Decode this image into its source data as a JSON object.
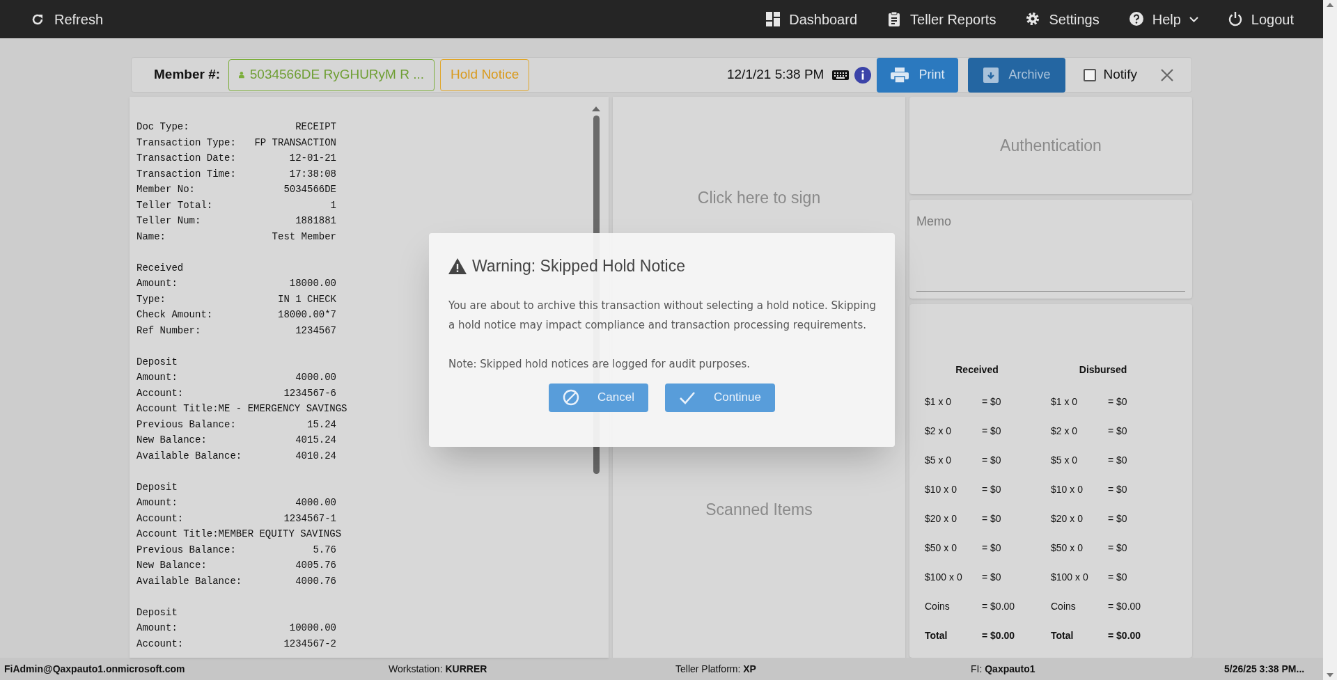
{
  "top_bar": {
    "refresh": "Refresh",
    "nav": [
      {
        "kind": "dashboard",
        "label": "Dashboard",
        "caret": false
      },
      {
        "kind": "reports",
        "label": "Teller Reports",
        "caret": false
      },
      {
        "kind": "settings",
        "label": "Settings",
        "caret": false
      },
      {
        "kind": "help",
        "label": "Help",
        "caret": true
      },
      {
        "kind": "logout",
        "label": "Logout",
        "caret": false
      }
    ]
  },
  "header": {
    "member_label": "Member #:",
    "member_value": "5034566DE RyGHURyM R ...",
    "hold_notice": "Hold Notice",
    "datetime": "12/1/21 5:38 PM",
    "print": "Print",
    "archive": "Archive",
    "notify": {
      "label": "Notify",
      "checked": false
    }
  },
  "receipt": {
    "sections": [
      {
        "rows": [
          {
            "kind": "pair",
            "label": "Doc Type:",
            "value": "RECEIPT"
          },
          {
            "kind": "pair",
            "label": "Transaction Type:",
            "value": "FP TRANSACTION"
          },
          {
            "kind": "pair",
            "label": "Transaction Date:",
            "value": "12-01-21"
          },
          {
            "kind": "pair",
            "label": "Transaction Time:",
            "value": "17:38:08"
          },
          {
            "kind": "pair",
            "label": "Member No:",
            "value": "5034566DE"
          },
          {
            "kind": "pair",
            "label": "Teller Total:",
            "value": "1"
          },
          {
            "kind": "pair",
            "label": "Teller Num:",
            "value": "1881881"
          },
          {
            "kind": "pair",
            "label": "Name:",
            "value": "Test Member"
          }
        ]
      },
      {
        "heading": "Received",
        "rows": [
          {
            "kind": "pair",
            "label": "Amount:",
            "value": "18000.00"
          },
          {
            "kind": "pair",
            "label": "Type:",
            "value": "IN 1 CHECK"
          },
          {
            "kind": "pair",
            "label": "Check Amount:",
            "value": "18000.00*7"
          },
          {
            "kind": "pair",
            "label": "Ref Number:",
            "value": "1234567"
          }
        ]
      },
      {
        "heading": "Deposit",
        "rows": [
          {
            "kind": "pair",
            "label": "Amount:",
            "value": "4000.00"
          },
          {
            "kind": "pair",
            "label": "Account:",
            "value": "1234567-6"
          },
          {
            "kind": "line",
            "text": "Account Title:ME - EMERGENCY SAVINGS"
          },
          {
            "kind": "pair",
            "label": "Previous Balance:",
            "value": "15.24"
          },
          {
            "kind": "pair",
            "label": "New Balance:",
            "value": "4015.24"
          },
          {
            "kind": "pair",
            "label": "Available Balance:",
            "value": "4010.24"
          }
        ]
      },
      {
        "heading": "Deposit",
        "rows": [
          {
            "kind": "pair",
            "label": "Amount:",
            "value": "4000.00"
          },
          {
            "kind": "pair",
            "label": "Account:",
            "value": "1234567-1"
          },
          {
            "kind": "line",
            "text": "Account Title:MEMBER EQUITY SAVINGS"
          },
          {
            "kind": "pair",
            "label": "Previous Balance:",
            "value": "5.76"
          },
          {
            "kind": "pair",
            "label": "New Balance:",
            "value": "4005.76"
          },
          {
            "kind": "pair",
            "label": "Available Balance:",
            "value": "4000.76"
          }
        ]
      },
      {
        "heading": "Deposit",
        "rows": [
          {
            "kind": "pair",
            "label": "Amount:",
            "value": "10000.00"
          },
          {
            "kind": "pair",
            "label": "Account:",
            "value": "1234567-2"
          }
        ]
      }
    ]
  },
  "signature": {
    "prompt": "Click here to sign",
    "scanned": "Scanned Items"
  },
  "authentication": "Authentication",
  "memo": {
    "placeholder": "Memo"
  },
  "cash": {
    "columns": [
      {
        "heading": "Received",
        "rows": [
          {
            "label": "$1 x 0",
            "value": "= $0",
            "total": false
          },
          {
            "label": "$2 x 0",
            "value": "= $0",
            "total": false
          },
          {
            "label": "$5 x 0",
            "value": "= $0",
            "total": false
          },
          {
            "label": "$10 x 0",
            "value": "= $0",
            "total": false
          },
          {
            "label": "$20 x 0",
            "value": "= $0",
            "total": false
          },
          {
            "label": "$50 x 0",
            "value": "= $0",
            "total": false
          },
          {
            "label": "$100 x 0",
            "value": "= $0",
            "total": false
          },
          {
            "label": "Coins",
            "value": "= $0.00",
            "total": false
          },
          {
            "label": "Total",
            "value": "= $0.00",
            "total": true
          }
        ]
      },
      {
        "heading": "Disbursed",
        "rows": [
          {
            "label": "$1 x 0",
            "value": "= $0",
            "total": false
          },
          {
            "label": "$2 x 0",
            "value": "= $0",
            "total": false
          },
          {
            "label": "$5 x 0",
            "value": "= $0",
            "total": false
          },
          {
            "label": "$10 x 0",
            "value": "= $0",
            "total": false
          },
          {
            "label": "$20 x 0",
            "value": "= $0",
            "total": false
          },
          {
            "label": "$50 x 0",
            "value": "= $0",
            "total": false
          },
          {
            "label": "$100 x 0",
            "value": "= $0",
            "total": false
          },
          {
            "label": "Coins",
            "value": "= $0.00",
            "total": false
          },
          {
            "label": "Total",
            "value": "= $0.00",
            "total": true
          }
        ]
      }
    ]
  },
  "dialog": {
    "title": "Warning: Skipped Hold Notice",
    "body": "You are about to archive this transaction without selecting a hold notice. Skipping a hold notice may impact compliance and transaction processing requirements.",
    "note": "Note: Skipped hold notices are logged for audit purposes.",
    "buttons": [
      {
        "kind": "cancel",
        "label": "Cancel"
      },
      {
        "kind": "continue",
        "label": "Continue"
      }
    ]
  },
  "status_bar": {
    "user": "FiAdmin@Qaxpauto1.onmicrosoft.com",
    "items": [
      {
        "label": "Workstation:",
        "value": "KURRER"
      },
      {
        "label": "Teller Platform:",
        "value": "XP"
      },
      {
        "label": "FI:",
        "value": "Qaxpauto1"
      }
    ],
    "datetime": "5/26/25 3:38 PM..."
  }
}
